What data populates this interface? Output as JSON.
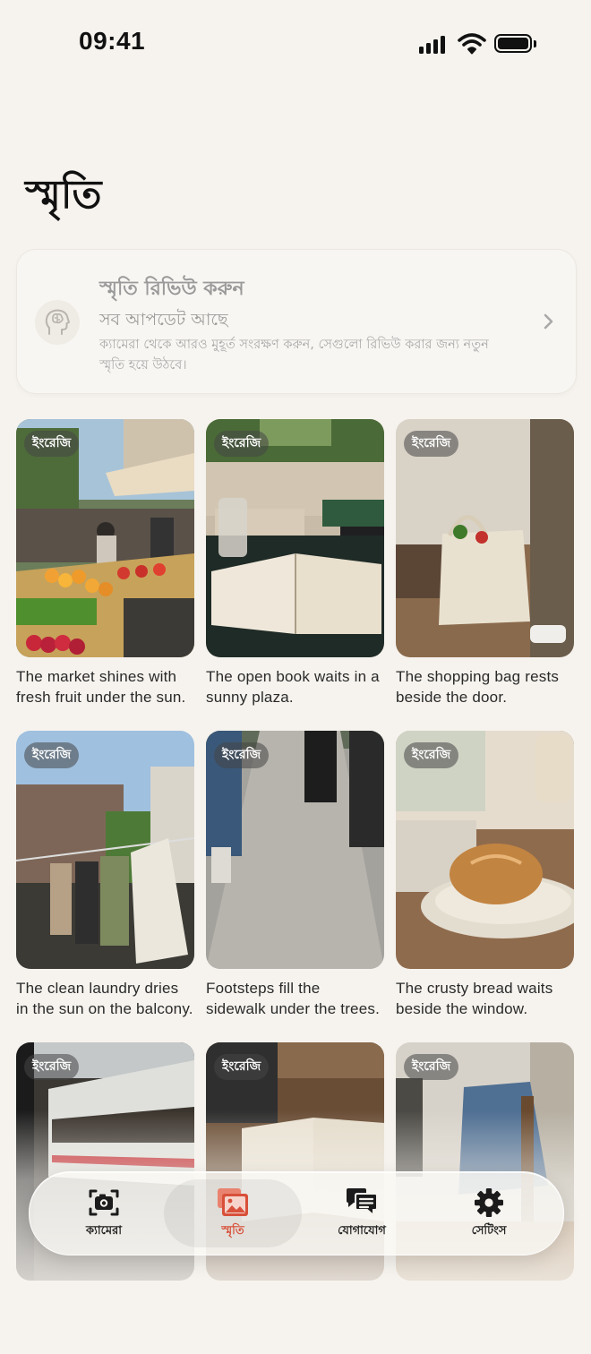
{
  "status_bar": {
    "time": "09:41"
  },
  "page": {
    "title": "স্মৃতি"
  },
  "review_card": {
    "title": "স্মৃতি রিভিউ করুন",
    "subtitle": "সব আপডেট আছে",
    "description": "ক্যামেরা থেকে আরও মুহূর্ত সংরক্ষণ করুন, সেগুলো রিভিউ করার জন্য নতুন স্মৃতি হয়ে উঠবে।",
    "icon": "brain-head-icon"
  },
  "memories": [
    {
      "badge": "ইংরেজি",
      "caption": "The market shines with fresh fruit under the sun."
    },
    {
      "badge": "ইংরেজি",
      "caption": "The open book waits in a sunny plaza."
    },
    {
      "badge": "ইংরেজি",
      "caption": "The shopping bag rests beside the door."
    },
    {
      "badge": "ইংরেজি",
      "caption": "The clean laundry dries in the sun on the balcony."
    },
    {
      "badge": "ইংরেজি",
      "caption": "Footsteps fill the sidewalk under the trees."
    },
    {
      "badge": "ইংরেজি",
      "caption": "The crusty bread waits beside the window."
    },
    {
      "badge": "ইংরেজি",
      "caption": ""
    },
    {
      "badge": "ইংরেজি",
      "caption": ""
    },
    {
      "badge": "ইংরেজি",
      "caption": ""
    }
  ],
  "tab_bar": {
    "tabs": [
      {
        "label": "ক্যামেরা",
        "icon": "camera-icon"
      },
      {
        "label": "স্মৃতি",
        "icon": "photos-icon"
      },
      {
        "label": "যোগাযোগ",
        "icon": "chat-icon"
      },
      {
        "label": "সেটিংস",
        "icon": "gear-icon"
      }
    ],
    "selected_index": 1
  },
  "colors": {
    "background": "#f6f3ee",
    "accent": "#d8503a",
    "text_primary": "#111111",
    "text_muted": "#9a9a9a"
  }
}
